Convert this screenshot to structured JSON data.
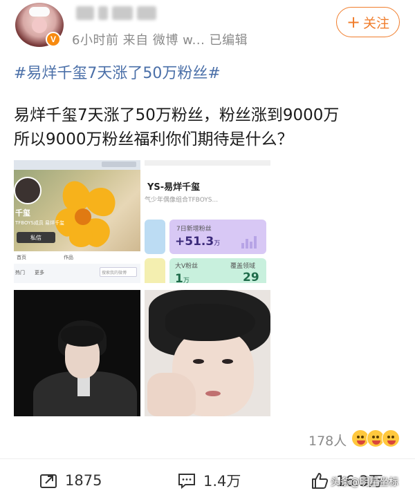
{
  "header": {
    "meta": "6小时前  来自 微博 w...  已编辑",
    "follow_label": "关注",
    "follow_icon": "plus-icon",
    "avatar_badge": "V"
  },
  "post": {
    "hashtag": "#易烊千玺7天涨了50万粉丝#",
    "text_lines": [
      "易烊千玺7天涨了50万粉丝，粉丝涨到9000万",
      "所以9000万粉丝福利你们期待是什么？"
    ]
  },
  "screenshot1": {
    "name": "千玺",
    "subtitle": "TFBOYS成员 易烊千玺",
    "msg_button": "私信",
    "tabs": [
      "首页",
      "作品"
    ],
    "subbar": [
      "热门",
      "更多"
    ],
    "search_placeholder": "搜索我的微博"
  },
  "screenshot2": {
    "title": "YS-易烊千玺",
    "subtitle": "气少年偶像组合TFBOYS...",
    "stat1_label": "7日新增粉丝",
    "stat1_value": "+51.3",
    "stat1_unit": "万",
    "stat2_label": "大V粉丝",
    "stat2_value": "1",
    "stat2_unit": "万",
    "stat3_label": "覆盖领域",
    "stat3_value": "29"
  },
  "reactions": {
    "count": "178人",
    "emojis": [
      "laugh-emoji",
      "shocked-emoji",
      "grin-emoji"
    ]
  },
  "actions": {
    "repost_count": "1875",
    "comment_count": "1.4万",
    "like_count": "16.3万"
  },
  "watermark": "头条@明星坐标",
  "colors": {
    "accent": "#f07c2a",
    "hashtag": "#4a6fa8",
    "meta": "#8a8a8a"
  }
}
